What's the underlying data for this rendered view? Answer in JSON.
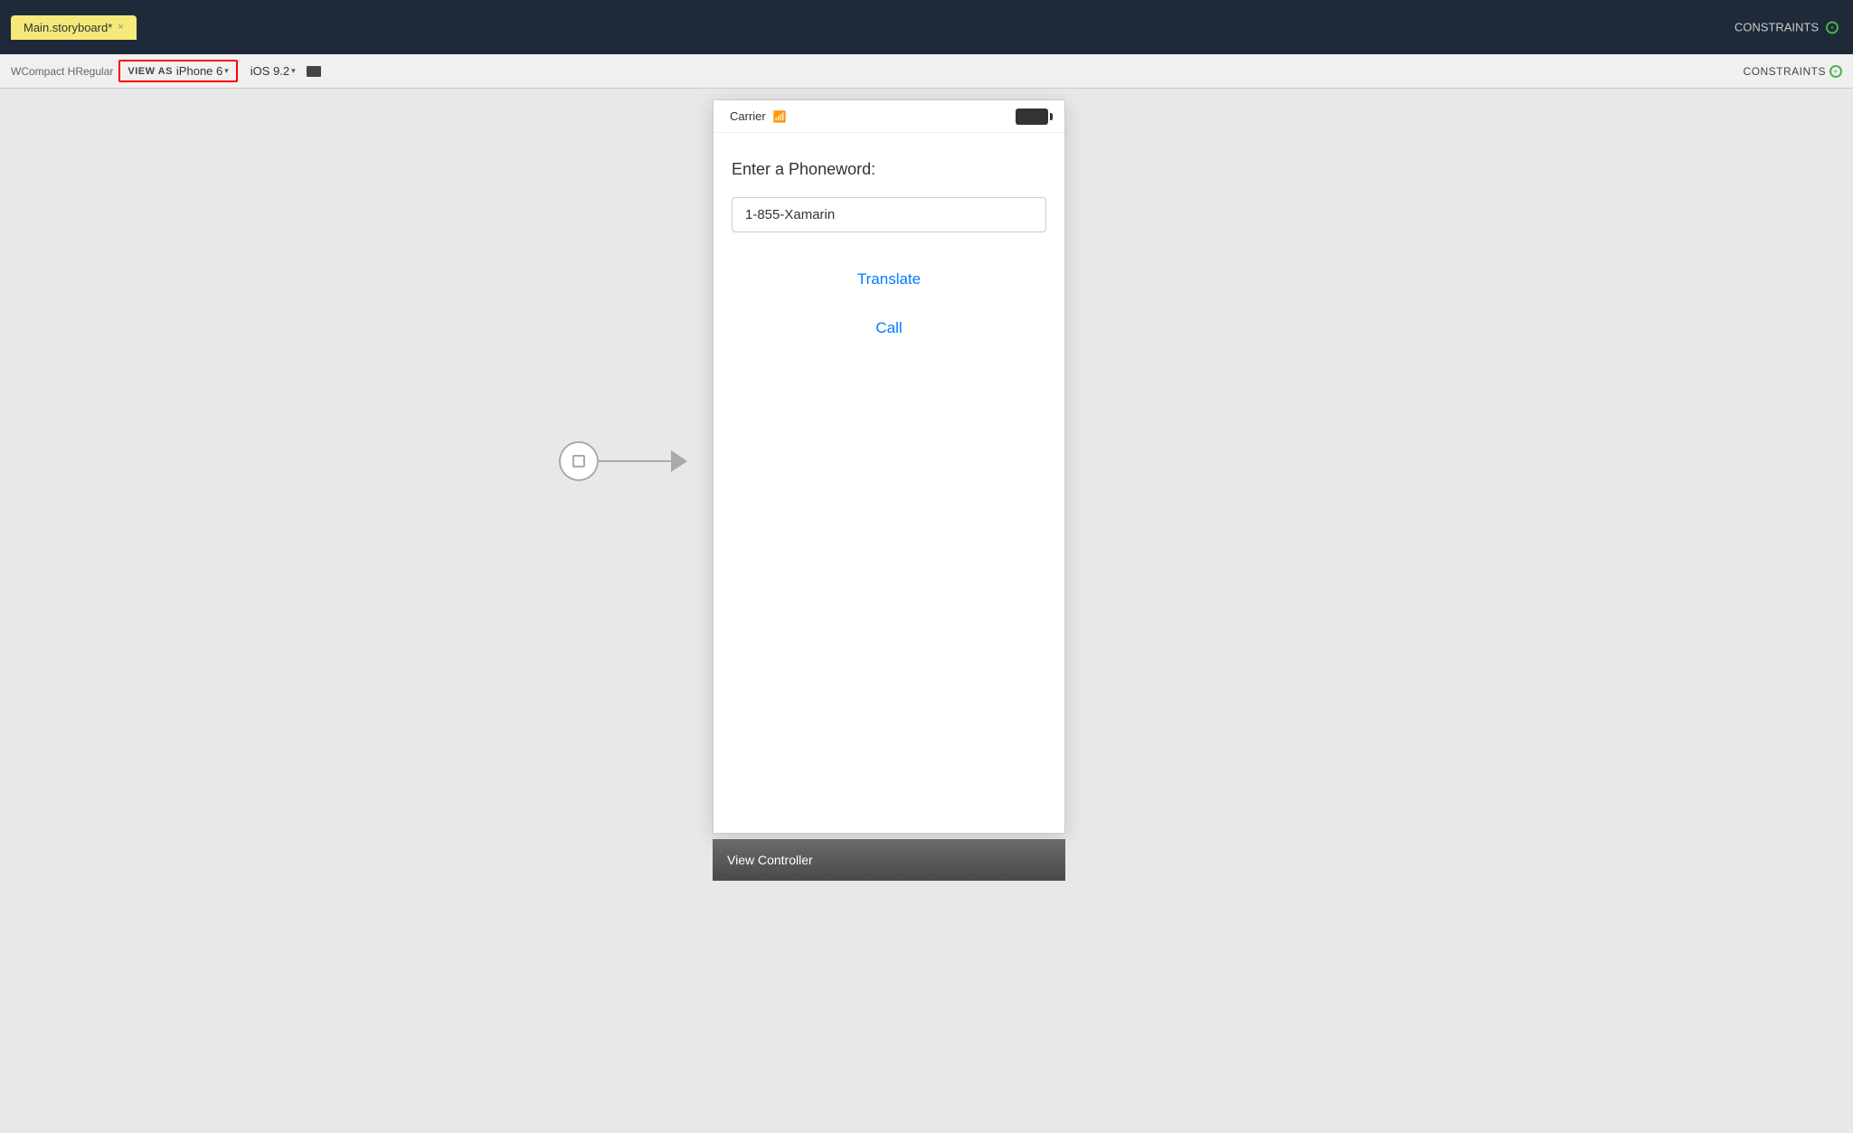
{
  "top_bar": {
    "tab_title": "Main.storyboard*",
    "close_symbol": "×",
    "constraints_label": "CONSTRAINTS"
  },
  "secondary_bar": {
    "view_as_label": "VIEW AS",
    "iphone_label": "iPhone 6",
    "ios_label": "iOS 9.2",
    "traits_label": "WCompact HRegular",
    "constraints_label": "CONSTRAINTS"
  },
  "canvas": {
    "entry_arrow_visible": true
  },
  "iphone": {
    "status_bar": {
      "carrier": "Carrier",
      "battery_full": true
    },
    "content": {
      "phoneword_label": "Enter a Phoneword:",
      "input_value": "1-855-Xamarin",
      "translate_button": "Translate",
      "call_button": "Call"
    }
  },
  "view_controller": {
    "label": "View Controller"
  },
  "colors": {
    "accent_blue": "#007aff",
    "background": "#e8e8e8",
    "top_bar": "#1e2a3a",
    "secondary_bar": "#f0f0f0",
    "tab_yellow": "#f5e97a",
    "vc_bar_start": "#6b6b6b",
    "vc_bar_end": "#4a4a4a",
    "red_border": "#ff0000",
    "green_dot": "#4caf50"
  }
}
